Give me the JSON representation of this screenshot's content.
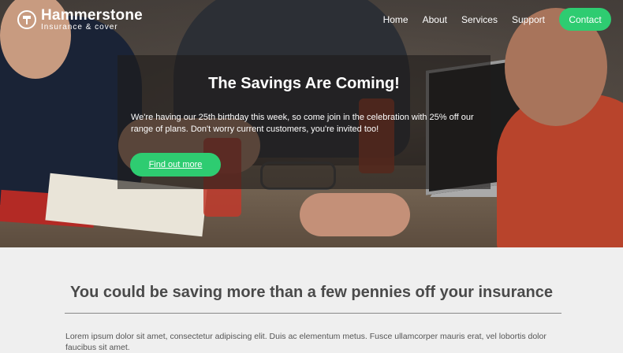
{
  "brand": {
    "name": "Hammerstone",
    "tagline": "Insurance & cover",
    "icon": "hammer-icon"
  },
  "nav": {
    "items": [
      "Home",
      "About",
      "Services",
      "Support"
    ],
    "contact_label": "Contact"
  },
  "hero": {
    "title": "The Savings Are Coming!",
    "body": "We're having our 25th birthday this week, so come join in the celebration with 25% off our range of plans. Don't worry current customers, you're invited too!",
    "cta_label": "Find out more"
  },
  "section": {
    "heading": "You could be saving more than a few pennies off your insurance",
    "body": "Lorem ipsum dolor sit amet, consectetur adipiscing elit. Duis ac elementum metus. Fusce ullamcorper mauris erat, vel lobortis dolor faucibus sit amet."
  },
  "colors": {
    "accent": "#2ecc71",
    "text_dark": "#4a4a4a"
  }
}
